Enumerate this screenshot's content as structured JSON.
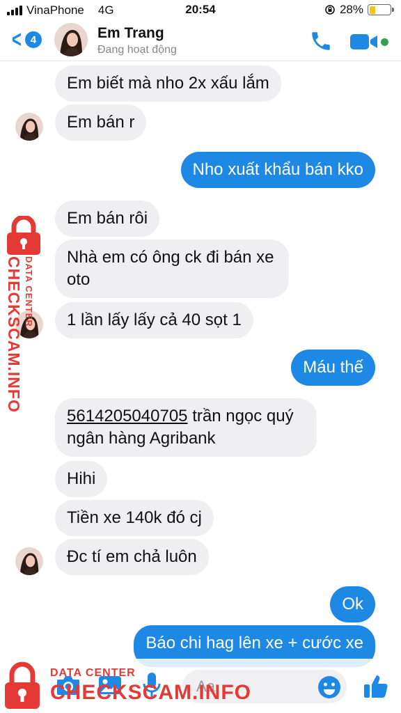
{
  "status": {
    "carrier": "VinaPhone",
    "network": "4G",
    "time": "20:54",
    "battery": "28%",
    "battery_level": 0.28
  },
  "header": {
    "back_count": "4",
    "contact_name": "Em Trang",
    "presence": "Đang hoạt động"
  },
  "messages": [
    {
      "from": "them",
      "text": "Em biết mà nho 2x xấu lắm"
    },
    {
      "from": "them",
      "text": "Em bán r"
    },
    {
      "from": "me",
      "text": "Nho xuất khẩu bán kko"
    },
    {
      "from": "them",
      "text": "Em bán rôi"
    },
    {
      "from": "them",
      "text": "Nhà em có ông ck đi bán xe oto"
    },
    {
      "from": "them",
      "text": "1 lần lấy lấy cả 40 sọt 1"
    },
    {
      "from": "me",
      "text": "Máu thế"
    },
    {
      "from": "them",
      "account": "5614205040705",
      "text": " trần ngọc quý  ngân hàng Agribank"
    },
    {
      "from": "them",
      "text": "Hihi"
    },
    {
      "from": "them",
      "text": "Tiền xe 140k đó cj"
    },
    {
      "from": "them",
      "text": "Đc tí em chả luôn"
    },
    {
      "from": "me",
      "text": "Ok"
    },
    {
      "from": "me",
      "text": "Báo chi hag lên xe + cước xe"
    }
  ],
  "composer": {
    "placeholder": "Aa"
  },
  "watermark": {
    "brand": "CHECKSCAM.INFO",
    "tagline": "DATA CENTER",
    "color": "#e53935"
  },
  "colors": {
    "accent": "#1e88e5",
    "incoming_bubble": "#efeff1",
    "online": "#31a24c"
  }
}
